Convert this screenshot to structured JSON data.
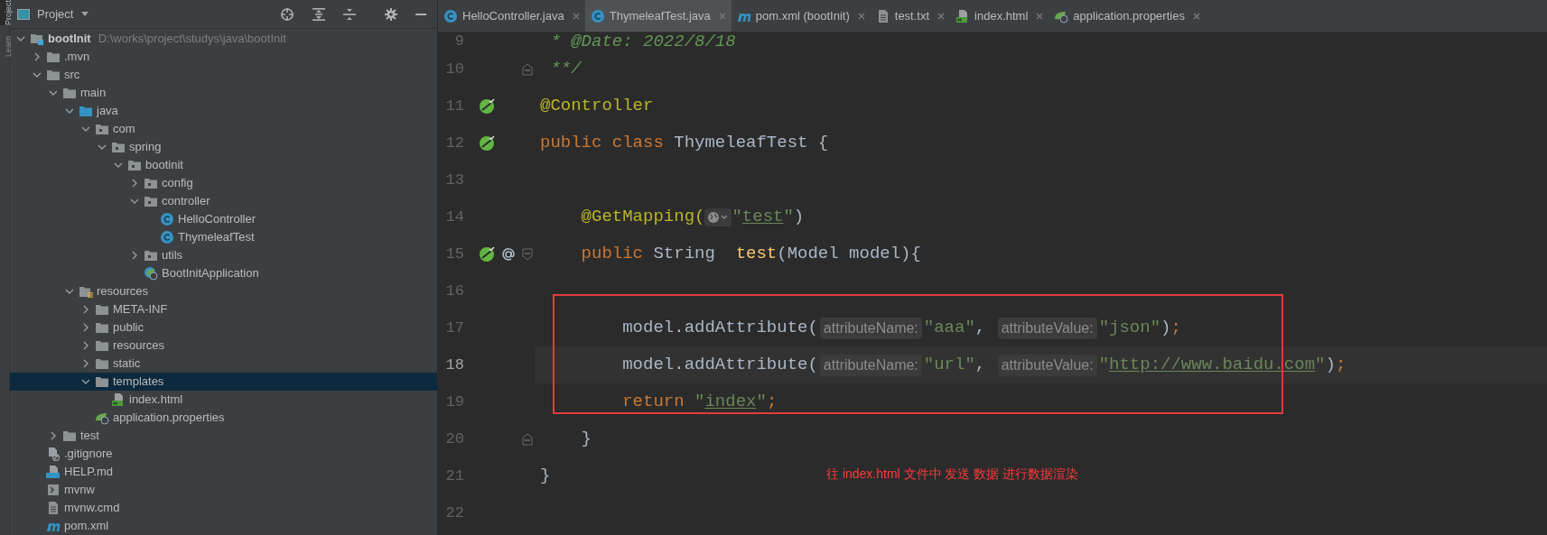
{
  "tool_strip": [
    {
      "label": "Project",
      "selected": true
    },
    {
      "label": "Learn",
      "selected": false
    }
  ],
  "project_panel": {
    "title": "Project",
    "tree": [
      {
        "label": "bootInit",
        "kind": "module",
        "path": "D:\\works\\project\\studys\\java\\bootInit",
        "expanded": true,
        "selected": false,
        "children": [
          {
            "label": ".mvn",
            "kind": "folder",
            "expanded": false,
            "selected": false
          },
          {
            "label": "src",
            "kind": "folder",
            "expanded": true,
            "selected": false,
            "children": [
              {
                "label": "main",
                "kind": "folder",
                "expanded": true,
                "selected": false,
                "children": [
                  {
                    "label": "java",
                    "kind": "source",
                    "expanded": true,
                    "selected": false,
                    "children": [
                      {
                        "label": "com",
                        "kind": "package",
                        "expanded": true,
                        "selected": false,
                        "children": [
                          {
                            "label": "spring",
                            "kind": "package",
                            "expanded": true,
                            "selected": false,
                            "children": [
                              {
                                "label": "bootinit",
                                "kind": "package",
                                "expanded": true,
                                "selected": false,
                                "children": [
                                  {
                                    "label": "config",
                                    "kind": "package",
                                    "expanded": false,
                                    "selected": false
                                  },
                                  {
                                    "label": "controller",
                                    "kind": "package",
                                    "expanded": true,
                                    "selected": false,
                                    "children": [
                                      {
                                        "label": "HelloController",
                                        "kind": "class",
                                        "selected": false
                                      },
                                      {
                                        "label": "ThymeleafTest",
                                        "kind": "class",
                                        "selected": false
                                      }
                                    ]
                                  },
                                  {
                                    "label": "utils",
                                    "kind": "package",
                                    "expanded": false,
                                    "selected": false
                                  },
                                  {
                                    "label": "BootInitApplication",
                                    "kind": "spring-app",
                                    "selected": false
                                  }
                                ]
                              }
                            ]
                          }
                        ]
                      }
                    ]
                  },
                  {
                    "label": "resources",
                    "kind": "resources",
                    "expanded": true,
                    "selected": false,
                    "children": [
                      {
                        "label": "META-INF",
                        "kind": "folder",
                        "expanded": false,
                        "selected": false
                      },
                      {
                        "label": "public",
                        "kind": "folder",
                        "expanded": false,
                        "selected": false
                      },
                      {
                        "label": "resources",
                        "kind": "folder",
                        "expanded": false,
                        "selected": false
                      },
                      {
                        "label": "static",
                        "kind": "folder",
                        "expanded": false,
                        "selected": false
                      },
                      {
                        "label": "templates",
                        "kind": "folder",
                        "expanded": true,
                        "selected": true,
                        "children": [
                          {
                            "label": "index.html",
                            "kind": "html",
                            "selected": false
                          }
                        ]
                      },
                      {
                        "label": "application.properties",
                        "kind": "properties",
                        "selected": false
                      }
                    ]
                  }
                ]
              },
              {
                "label": "test",
                "kind": "folder",
                "expanded": false,
                "selected": false
              }
            ]
          },
          {
            "label": ".gitignore",
            "kind": "ignore",
            "selected": false
          },
          {
            "label": "HELP.md",
            "kind": "markdown",
            "selected": false
          },
          {
            "label": "mvnw",
            "kind": "script",
            "selected": false
          },
          {
            "label": "mvnw.cmd",
            "kind": "text",
            "selected": false
          },
          {
            "label": "pom.xml",
            "kind": "maven",
            "selected": false
          }
        ]
      }
    ]
  },
  "editor_tabs": [
    {
      "label": "HelloController.java",
      "kind": "class",
      "selected": false
    },
    {
      "label": "ThymeleafTest.java",
      "kind": "class",
      "selected": true
    },
    {
      "label": "pom.xml (bootInit)",
      "kind": "maven",
      "selected": false
    },
    {
      "label": "test.txt",
      "kind": "text",
      "selected": false
    },
    {
      "label": "index.html",
      "kind": "html",
      "selected": false
    },
    {
      "label": "application.properties",
      "kind": "properties",
      "selected": false
    }
  ],
  "code_lines": [
    {
      "number": "9",
      "current": false,
      "tokens": [
        {
          "kind": "comment",
          "text": " * @Date: 2022/8/18"
        }
      ]
    },
    {
      "number": "10",
      "current": false,
      "fold_marker": {
        "kind": "end"
      },
      "tokens": [
        {
          "kind": "comment",
          "text": " **/"
        }
      ]
    },
    {
      "number": "11",
      "current": false,
      "gutter": [
        {
          "kind": "bean"
        }
      ],
      "tokens": [
        {
          "kind": "annotation",
          "text": "@Controller"
        }
      ]
    },
    {
      "number": "12",
      "current": false,
      "gutter": [
        {
          "kind": "bean"
        }
      ],
      "tokens": [
        {
          "kind": "keyword",
          "text": "public class "
        },
        {
          "kind": "plain",
          "text": "ThymeleafTest {"
        }
      ]
    },
    {
      "number": "13",
      "current": false
    },
    {
      "number": "14",
      "current": false,
      "tokens": [
        {
          "kind": "annotation",
          "text": "    @GetMapping("
        },
        {
          "kind": "url-icon"
        },
        {
          "kind": "string",
          "text": "\""
        },
        {
          "kind": "link",
          "text": "test"
        },
        {
          "kind": "string",
          "text": "\""
        },
        {
          "kind": "plain",
          "text": ")"
        }
      ]
    },
    {
      "number": "15",
      "current": false,
      "gutter": [
        {
          "kind": "bean"
        },
        {
          "kind": "at"
        }
      ],
      "fold_marker": {
        "kind": "start"
      },
      "tokens": [
        {
          "kind": "keyword",
          "text": "    public "
        },
        {
          "kind": "plain",
          "text": "String  "
        },
        {
          "kind": "method",
          "text": "test"
        },
        {
          "kind": "plain",
          "text": "(Model model){"
        }
      ]
    },
    {
      "number": "16",
      "current": false
    },
    {
      "number": "17",
      "current": false,
      "tokens": [
        {
          "kind": "plain",
          "text": "        model.addAttribute("
        },
        {
          "kind": "hint",
          "text": "attributeName:"
        },
        {
          "kind": "string",
          "text": "\"aaa\""
        },
        {
          "kind": "plain",
          "text": ", "
        },
        {
          "kind": "hint",
          "text": "attributeValue:"
        },
        {
          "kind": "string",
          "text": "\"json\""
        },
        {
          "kind": "plain",
          "text": ")"
        },
        {
          "kind": "keyword",
          "text": ";"
        }
      ]
    },
    {
      "number": "18",
      "current": true,
      "tokens": [
        {
          "kind": "plain",
          "text": "        model.addAttribute("
        },
        {
          "kind": "hint",
          "text": "attributeName:"
        },
        {
          "kind": "string",
          "text": "\"url\""
        },
        {
          "kind": "plain",
          "text": ", "
        },
        {
          "kind": "hint",
          "text": "attributeValue:"
        },
        {
          "kind": "string",
          "text": "\""
        },
        {
          "kind": "link",
          "text": "http://www.baidu.com"
        },
        {
          "kind": "string",
          "text": "\""
        },
        {
          "kind": "plain",
          "text": ")"
        },
        {
          "kind": "keyword",
          "text": ";"
        }
      ]
    },
    {
      "number": "19",
      "current": false,
      "tokens": [
        {
          "kind": "keyword",
          "text": "        return "
        },
        {
          "kind": "string",
          "text": "\""
        },
        {
          "kind": "link",
          "text": "index"
        },
        {
          "kind": "string",
          "text": "\""
        },
        {
          "kind": "keyword",
          "text": ";"
        }
      ]
    },
    {
      "number": "20",
      "current": false,
      "fold_marker": {
        "kind": "end"
      },
      "tokens": [
        {
          "kind": "plain",
          "text": "    }"
        }
      ]
    },
    {
      "number": "21",
      "current": false,
      "tokens": [
        {
          "kind": "plain",
          "text": "}"
        }
      ]
    },
    {
      "number": "22",
      "current": false
    }
  ],
  "annotation": {
    "frame": true,
    "note": "往 index.html 文件中  发送 数据  进行数据渲染"
  }
}
